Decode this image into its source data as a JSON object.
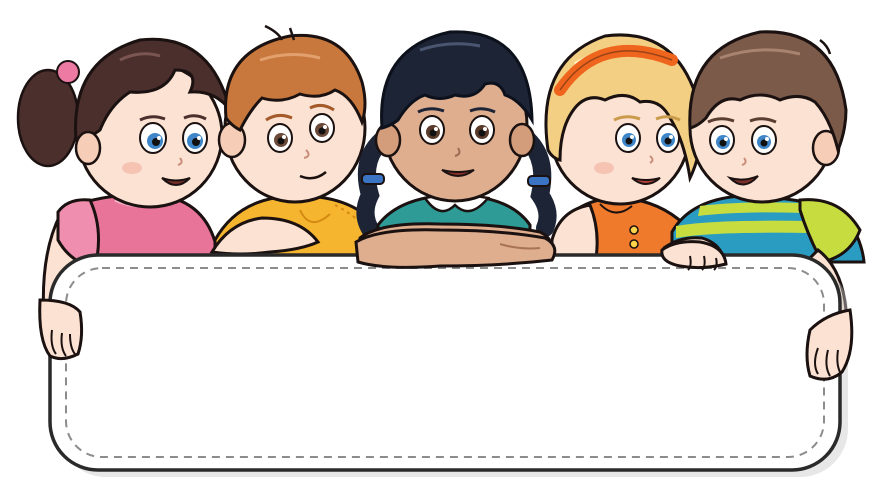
{
  "illustration": {
    "subject": "five-cartoon-kids-holding-blank-sign",
    "sign_text": "",
    "colors": {
      "background": "#ffffff",
      "sign_fill": "#ffffff",
      "sign_outline": "#2a2a2a",
      "sign_dash": "#8c8c8c",
      "skin_light": "#fbe2d2",
      "skin_tan": "#deae8f",
      "hair_dark_brown": "#4a2f2c",
      "hair_ginger": "#c9783d",
      "hair_black": "#1c2436",
      "hair_blonde": "#f2cf83",
      "hair_brown": "#7b5a4a",
      "shirt_pink": "#e8749a",
      "shirt_yellow": "#f6b52f",
      "shirt_teal": "#2e9b96",
      "shirt_orange": "#ef7a2c",
      "shirt_lime": "#c7dd3f",
      "headband_orange": "#f0651d",
      "eye_blue": "#3f86c8"
    },
    "children": [
      {
        "name": "girl-pink-dress",
        "hair": "dark-brown-pigtail"
      },
      {
        "name": "boy-yellow-shirt",
        "hair": "ginger"
      },
      {
        "name": "girl-teal-top",
        "hair": "black-braids"
      },
      {
        "name": "girl-orange-dress",
        "hair": "blonde-with-headband"
      },
      {
        "name": "boy-striped-shirt",
        "hair": "brown"
      }
    ]
  }
}
